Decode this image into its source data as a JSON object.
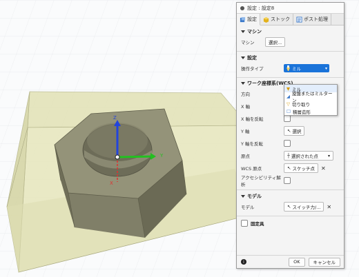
{
  "dialog": {
    "title": "設定 : 設定8",
    "tabs": [
      {
        "label": "設定",
        "icon": "settings-tab-icon"
      },
      {
        "label": "ストック",
        "icon": "stock-cube-icon"
      },
      {
        "label": "ポスト処理",
        "icon": "post-process-icon"
      }
    ],
    "machine": {
      "header": "マシン",
      "label": "マシン",
      "button": "選択..."
    },
    "setup": {
      "header": "設定",
      "op_type_label": "操作タイプ",
      "op_type_value": "ミル"
    },
    "op_type_options": [
      "ミル",
      "旋盤またはミルターン",
      "切り取り",
      "積層造形"
    ],
    "wcs": {
      "header": "ワーク座標系(WCS)",
      "orientation_label": "方向",
      "x_axis_label": "X 軸",
      "flip_x_label": "X 軸を反転",
      "y_axis_label": "Y 軸",
      "y_axis_button": "選択",
      "flip_y_label": "Y 軸を反転",
      "origin_label": "原点",
      "origin_value": "選択された点",
      "wcs_origin_label": "WCS 原点",
      "wcs_origin_button": "スケッチ点",
      "accessibility_label": "アクセシビリティ解析"
    },
    "model": {
      "header": "モデル",
      "label": "モデル",
      "button": "スイッチ力/..."
    },
    "fixture": {
      "label": "固定具"
    },
    "footer": {
      "ok": "OK",
      "cancel": "キャンセル"
    }
  },
  "triad": {
    "x_label": "X",
    "y_label": "Y",
    "z_label": "Z"
  },
  "colors": {
    "accent": "#1a73d9",
    "stock": "#d9d9a8",
    "part": "#7f7e68",
    "x_axis": "#e03030",
    "y_axis": "#22c020",
    "z_axis": "#2244dd"
  }
}
